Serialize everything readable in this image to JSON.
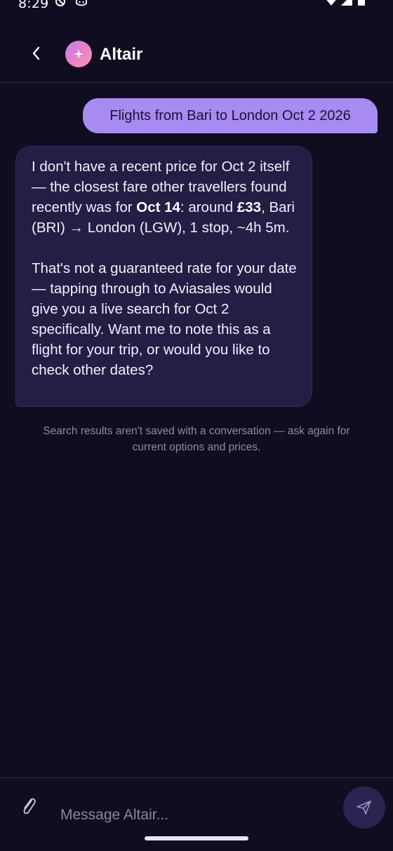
{
  "status_bar": {
    "time": "8:29",
    "icons": [
      "no-tracking-icon",
      "cat-face-icon",
      "wifi-icon",
      "signal-icon",
      "battery-icon"
    ]
  },
  "header": {
    "title": "Altair",
    "back_icon": "chevron-left-icon",
    "avatar_icon": "sparkle-icon"
  },
  "conversation": {
    "user_message": "Flights from Bari to London Oct 2 2026",
    "assistant_message": {
      "p1_a": "I don't have a recent price for Oct 2 itself — the closest fare other travellers found recently was for ",
      "p1_bold1": "Oct 14",
      "p1_b": ": around ",
      "p1_bold2": "£33",
      "p1_c": ", Bari (BRI) → London (LGW), 1 stop, ~4h 5m.",
      "p2": "That's not a guaranteed rate for your date — tapping through to Aviasales would give you a live search for Oct 2 specifically. Want me to note this as a flight for your trip, or would you like to check other dates?"
    },
    "notice": "Search results aren't saved with a conversation — ask again for current options and prices."
  },
  "composer": {
    "placeholder": "Message Altair...",
    "value": "",
    "attach_icon": "paperclip-icon",
    "send_icon": "send-icon"
  },
  "colors": {
    "background": "#0f0d1f",
    "user_bubble": "#a78bf0",
    "assistant_bubble": "#241e45",
    "accent_gradient_start": "#c07cf0",
    "accent_gradient_end": "#f39ab8"
  }
}
